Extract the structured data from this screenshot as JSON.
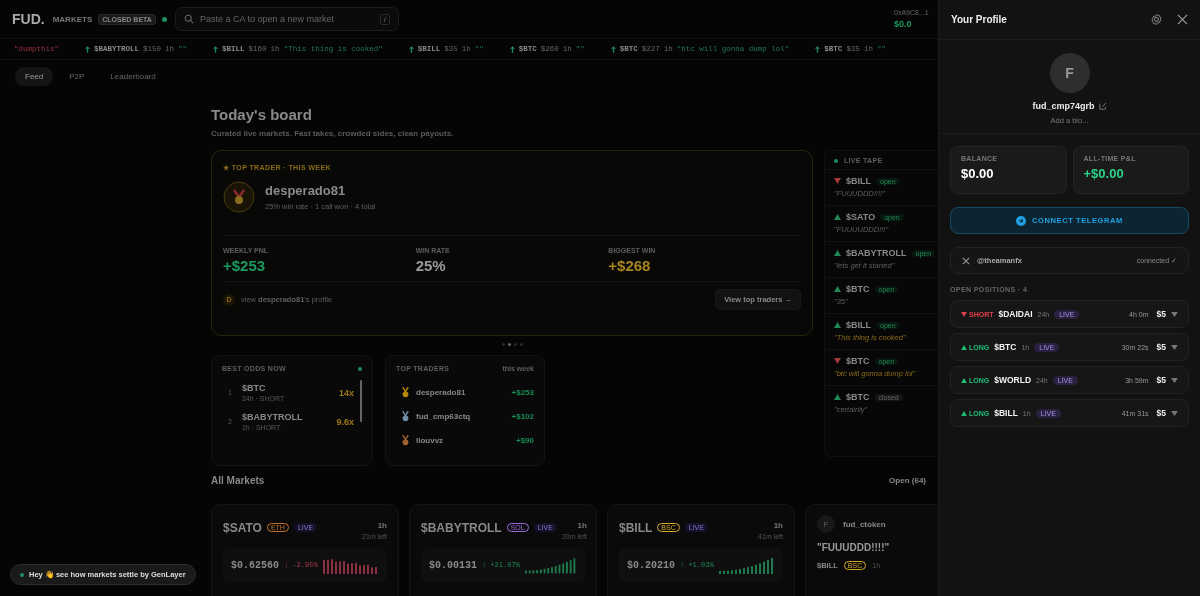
{
  "topbar": {
    "logo": "FUD.",
    "section": "MARKETS",
    "badge": "CLOSED BETA",
    "search": {
      "placeholder": "Paste a CA to open a new market",
      "shortcut": "/"
    },
    "wallet": {
      "address": "0xA9C8...1",
      "balance": "$0.0"
    }
  },
  "ticker": [
    {
      "up": false,
      "quote": "\"dumpthis\""
    },
    {
      "up": true,
      "ticker": "$BABYTROLL",
      "amount": "$150",
      "time": "1h",
      "quote": "\"\""
    },
    {
      "up": true,
      "ticker": "$BILL",
      "amount": "$160",
      "time": "1h",
      "quote": "\"This thing is cooked\""
    },
    {
      "up": true,
      "ticker": "$BILL",
      "amount": "$35",
      "time": "1h",
      "quote": "\"\""
    },
    {
      "up": true,
      "ticker": "$BTC",
      "amount": "$260",
      "time": "1h",
      "quote": "\"\""
    },
    {
      "up": true,
      "ticker": "$BTC",
      "amount": "$227",
      "time": "1h",
      "quote": "\"btc will gonna dump lol\""
    },
    {
      "up": true,
      "ticker": "$BTC",
      "amount": "$35",
      "time": "1h",
      "quote": "\"\""
    }
  ],
  "tabs": [
    {
      "label": "Feed",
      "selected": true
    },
    {
      "label": "P2P",
      "selected": false
    },
    {
      "label": "Leaderboard",
      "selected": false
    }
  ],
  "board": {
    "title": "Today's board",
    "subtitle": "Curated live markets. Fast takes, crowded sides, clean payouts.",
    "top_trader": {
      "label": "★ TOP TRADER · THIS WEEK",
      "name": "desperado81",
      "meta": "25% win rate · 1 call won · 4 total",
      "stats": [
        {
          "label": "WEEKLY PNL",
          "value": "+$253",
          "color": "#1a9a5f"
        },
        {
          "label": "WIN RATE",
          "value": "25%",
          "color": "#9a9a9a"
        },
        {
          "label": "BIGGEST WIN",
          "value": "+$268",
          "color": "#a8841c"
        }
      ],
      "avatar": "D",
      "profile_link": "view **desperado81**'s profile",
      "button": "View top traders →"
    },
    "dots": [
      {
        "selected": false
      },
      {
        "selected": true
      },
      {
        "selected": false
      },
      {
        "selected": false
      }
    ]
  },
  "best_odds": {
    "title": "BEST ODDS NOW",
    "rows": [
      {
        "rank": "1",
        "ticker": "$BTC",
        "meta": "24h · SHORT",
        "odds": "14x"
      },
      {
        "rank": "2",
        "ticker": "$BABYTROLL",
        "meta": "1h · SHORT",
        "odds": "9.6x"
      }
    ]
  },
  "top_traders": {
    "title": "TOP TRADERS",
    "period": "this week",
    "rows": [
      {
        "name": "desperado81",
        "pnl": "+$253",
        "color": "#b8860b"
      },
      {
        "name": "fud_cmp63ctq",
        "pnl": "+$102",
        "color": "#6f8fa8"
      },
      {
        "name": "llouvvz",
        "pnl": "+$90",
        "color": "#a0602a"
      }
    ]
  },
  "live_tape": {
    "title": "LIVE TAPE",
    "items": [
      {
        "up": false,
        "ticker": "$BILL",
        "status": "open",
        "closed": false,
        "quote": "\"FUUUDDD!!!!\"",
        "highlight": false
      },
      {
        "up": true,
        "ticker": "$SATO",
        "status": "open",
        "closed": false,
        "quote": "\"FUUUUDDD!!!\"",
        "highlight": false
      },
      {
        "up": true,
        "ticker": "$BABYTROLL",
        "status": "open",
        "closed": false,
        "quote": "\"lets get it started\"",
        "highlight": false
      },
      {
        "up": true,
        "ticker": "$BTC",
        "status": "open",
        "closed": false,
        "quote": "\"35\"",
        "highlight": false
      },
      {
        "up": true,
        "ticker": "$BILL",
        "status": "open",
        "closed": false,
        "quote": "\"This thing is cooked\"",
        "highlight": true
      },
      {
        "up": false,
        "ticker": "$BTC",
        "status": "open",
        "closed": false,
        "quote": "\"btc will gonna dump lol\"",
        "highlight": true
      },
      {
        "up": true,
        "ticker": "$BTC",
        "status": "closed",
        "closed": true,
        "quote": "\"certainly\"",
        "highlight": false
      }
    ]
  },
  "all_markets": {
    "title": "All Markets",
    "filter": "Open",
    "count": "(64)",
    "cards": [
      {
        "kind": "market",
        "ticker": "$SATO",
        "chain": "ETH",
        "color": "#c2732a",
        "status": "LIVE",
        "duration": "1h",
        "left": "21m left",
        "price": "$0.62560",
        "rising": false,
        "change": "↓ -2.95%"
      },
      {
        "kind": "market",
        "ticker": "$BABYTROLL",
        "chain": "SOL",
        "color": "#9b6bdc",
        "status": "LIVE",
        "duration": "1h",
        "left": "20m left",
        "price": "$0.00131",
        "rising": true,
        "change": "↑ +21.07%"
      },
      {
        "kind": "market",
        "ticker": "$BILL",
        "chain": "BSC",
        "color": "#d4a82a",
        "status": "LIVE",
        "duration": "1h",
        "left": "41m left",
        "price": "$0.20210",
        "rising": true,
        "change": "↑ +1.03%"
      },
      {
        "kind": "post",
        "avatar": "F",
        "author": "fud_ctoken",
        "quote": "\"FUUUDDD!!!!\"",
        "ticker": "$BILL",
        "chain": "BSC",
        "color": "#d4a82a",
        "duration": "1h"
      }
    ]
  },
  "toast": {
    "text": "Hey 👋 see how markets settle by GenLayer"
  },
  "profile": {
    "title": "Your Profile",
    "avatar": "F",
    "username": "fud_cmp74grb",
    "bio_placeholder": "Add a bio...",
    "stats": [
      {
        "label": "BALANCE",
        "value": "$0.00",
        "color": "#ffffff"
      },
      {
        "label": "ALL-TIME P&L",
        "value": "+$0.00",
        "color": "#2bd48a"
      }
    ],
    "telegram_button": "CONNECT TELEGRAM",
    "x_account": {
      "handle": "@theamanfx",
      "status": "connected ✓"
    },
    "positions_label": "OPEN POSITIONS · 4",
    "positions": [
      {
        "long": false,
        "label": "SHORT",
        "ticker": "$DAIDAI",
        "duration": "24h",
        "status": "LIVE",
        "time_left": "4h 0m",
        "stake": "$5"
      },
      {
        "long": true,
        "label": "LONG",
        "ticker": "$BTC",
        "duration": "1h",
        "status": "LIVE",
        "time_left": "30m 22s",
        "stake": "$5"
      },
      {
        "long": true,
        "label": "LONG",
        "ticker": "$WORLD",
        "duration": "24h",
        "status": "LIVE",
        "time_left": "3h 59m",
        "stake": "$5"
      },
      {
        "long": true,
        "label": "LONG",
        "ticker": "$BILL",
        "duration": "1h",
        "status": "LIVE",
        "time_left": "41m 31s",
        "stake": "$5"
      }
    ]
  }
}
